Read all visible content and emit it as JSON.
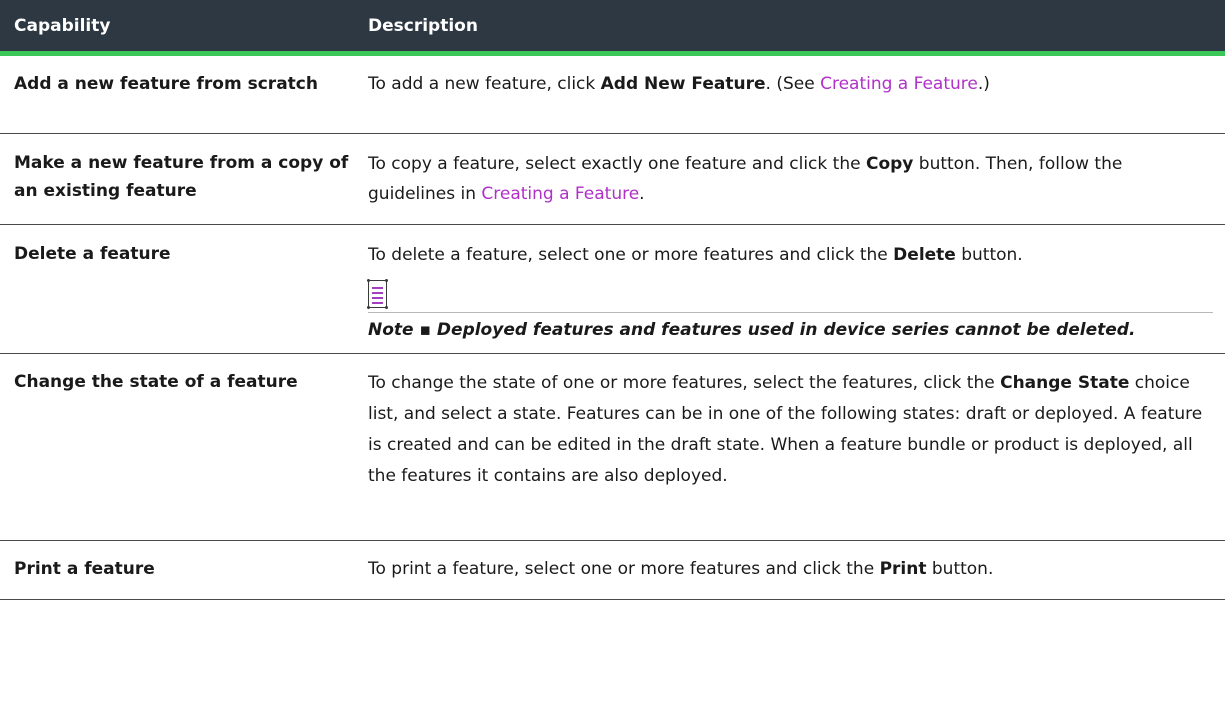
{
  "header": {
    "col1": "Capability",
    "col2": "Description"
  },
  "rows": [
    {
      "capability": "Add a new feature from scratch",
      "d1": "To add a new feature, click ",
      "d2": "Add New Feature",
      "d3": ". (See ",
      "link": "Creating a Feature",
      "d4": ".)"
    },
    {
      "capability": "Make a new feature from a copy of an existing feature",
      "d1": "To copy a feature, select exactly one feature and click the ",
      "d2": "Copy",
      "d3": " button. Then, follow the guidelines in ",
      "link": "Creating a Feature",
      "d4": "."
    },
    {
      "capability": "Delete a feature",
      "d1": "To delete a feature, select one or more features and click the ",
      "d2": "Delete",
      "d3": " button.",
      "note": "Note ▪ Deployed features and features used in device series cannot be deleted."
    },
    {
      "capability": "Change the state of a feature",
      "d1": "To change the state of one or more features, select the features, click the ",
      "d2": "Change State",
      "d3": " choice list, and select a state. Features can be in one of the following states: draft or deployed. A feature is created and can be edited in the draft state. When a feature bundle or product is deployed, all the features it contains are also deployed."
    },
    {
      "capability": "Print a feature",
      "d1": "To print a feature, select one or more features and click the ",
      "d2": "Print",
      "d3": " button."
    }
  ],
  "colors": {
    "header_bg": "#2d3843",
    "accent": "#3cc858",
    "link": "#b030c8"
  }
}
